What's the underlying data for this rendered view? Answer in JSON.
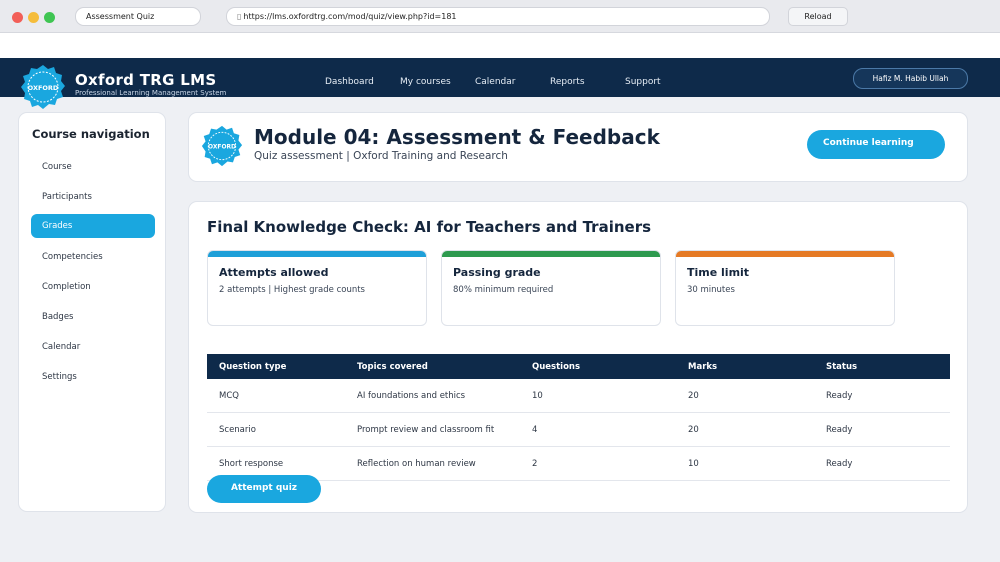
{
  "browser": {
    "tab_title": "Assessment Quiz",
    "url": "https://lms.oxfordtrg.com/mod/quiz/view.php?id=181",
    "reload_label": "Reload"
  },
  "header": {
    "logo_text": "OXFORD",
    "brand_title": "Oxford TRG LMS",
    "brand_subtitle": "Professional Learning Management System",
    "nav": [
      "Dashboard",
      "My courses",
      "Calendar",
      "Reports",
      "Support"
    ],
    "user_name": "Hafiz M. Habib Ullah"
  },
  "sidebar": {
    "title": "Course navigation",
    "items": [
      {
        "label": "Course",
        "active": false
      },
      {
        "label": "Participants",
        "active": false
      },
      {
        "label": "Grades",
        "active": true
      },
      {
        "label": "Competencies",
        "active": false
      },
      {
        "label": "Completion",
        "active": false
      },
      {
        "label": "Badges",
        "active": false
      },
      {
        "label": "Calendar",
        "active": false
      },
      {
        "label": "Settings",
        "active": false
      }
    ]
  },
  "module": {
    "badge_text": "OXFORD",
    "title": "Module 04: Assessment & Feedback",
    "subtitle": "Quiz assessment  |  Oxford Training and Research",
    "continue_label": "Continue learning"
  },
  "quiz": {
    "title": "Final Knowledge Check: AI for Teachers and Trainers",
    "info_cards": [
      {
        "label": "Attempts allowed",
        "value": "2 attempts | Highest grade counts",
        "color": "#1e9fd8"
      },
      {
        "label": "Passing grade",
        "value": "80% minimum required",
        "color": "#2e9a4f"
      },
      {
        "label": "Time limit",
        "value": "30 minutes",
        "color": "#e57a25"
      }
    ],
    "table": {
      "headers": [
        "Question type",
        "Topics covered",
        "Questions",
        "Marks",
        "Status"
      ],
      "rows": [
        [
          "MCQ",
          "AI foundations and ethics",
          "10",
          "20",
          "Ready"
        ],
        [
          "Scenario",
          "Prompt review and classroom fit",
          "4",
          "20",
          "Ready"
        ],
        [
          "Short response",
          "Reflection on human review",
          "2",
          "10",
          "Ready"
        ]
      ]
    },
    "attempt_label": "Attempt quiz"
  },
  "colors": {
    "navy": "#0e2a4a",
    "accent": "#1aa7df"
  }
}
